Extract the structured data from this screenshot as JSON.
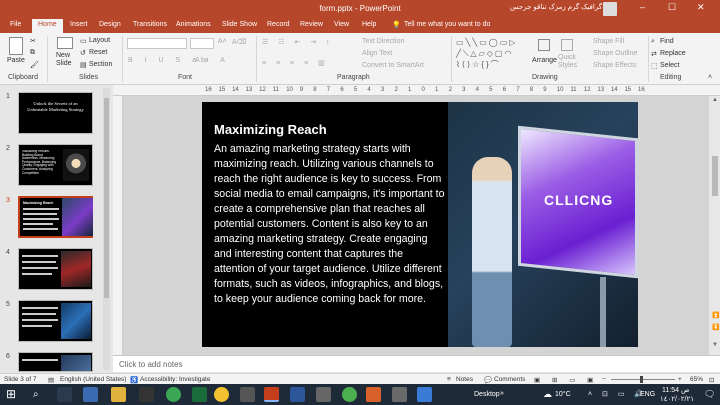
{
  "titlebar": {
    "autosave": "",
    "document": "form.pptx  -  PowerPoint",
    "user": "گرافیک گرم زمزک تناقو جرجس",
    "minimize": "–",
    "maximize": "☐",
    "close": "✕"
  },
  "ribbon_tabs": [
    "File",
    "Home",
    "Insert",
    "Design",
    "Transitions",
    "Animations",
    "Slide Show",
    "Record",
    "Review",
    "View",
    "Help"
  ],
  "tell_me": "Tell me what you want to do",
  "ribbon": {
    "clipboard": {
      "paste": "Paste",
      "label": "Clipboard"
    },
    "slides": {
      "new_slide": "New\nSlide",
      "layout": "Layout",
      "reset": "Reset",
      "section": "Section",
      "label": "Slides"
    },
    "font": {
      "label": "Font"
    },
    "paragraph": {
      "text_direction": "Text Direction",
      "align_text": "Align Text",
      "convert_smartart": "Convert to SmartArt",
      "label": "Paragraph"
    },
    "drawing": {
      "arrange": "Arrange",
      "quick_styles": "Quick\nStyles",
      "shape_fill": "Shape Fill",
      "shape_outline": "Shape Outline",
      "shape_effects": "Shape Effects",
      "label": "Drawing"
    },
    "editing": {
      "find": "Find",
      "replace": "Replace",
      "select": "Select",
      "label": "Editing"
    }
  },
  "thumbnails": [
    {
      "num": "1",
      "text": "Unlock the Secrets of an Unbeatable Marketing Strategy"
    },
    {
      "num": "2",
      "text": "Visualizing Results: Building Brand Awareness, Measuring Performance, Balancing Quality, Engaging with Customers, Analyzing Competition"
    },
    {
      "num": "3",
      "text": "Maximizing Reach"
    },
    {
      "num": "4",
      "text": ""
    },
    {
      "num": "5",
      "text": ""
    },
    {
      "num": "6",
      "text": ""
    }
  ],
  "ruler_ticks": [
    "16",
    "15",
    "14",
    "13",
    "12",
    "11",
    "10",
    "9",
    "8",
    "7",
    "6",
    "5",
    "4",
    "3",
    "2",
    "1",
    "0",
    "1",
    "2",
    "3",
    "4",
    "5",
    "6",
    "7",
    "8",
    "9",
    "10",
    "11",
    "12",
    "13",
    "14",
    "15",
    "16"
  ],
  "slide": {
    "heading": "Maximizing Reach",
    "body": "An amazing marketing strategy starts with maximizing reach. Utilizing various channels to reach the right audience is key to success. From social media to email campaigns, it's important to create a comprehensive plan that reaches all potential customers. Content is also key to an amazing marketing strategy. Create engaging and interesting content that captures the attention of your target audience. Utilize different formats, such as videos, infographics, and blogs, to keep your audience coming back for more.",
    "photo_screen_text": "CLLICNG"
  },
  "notes_placeholder": "Click to add notes",
  "status": {
    "slide_count": "Slide 3 of 7",
    "language": "English (United States)",
    "accessibility": "Accessibility: Investigate",
    "notes": "Notes",
    "comments": "Comments",
    "zoom": "65%"
  },
  "taskbar": {
    "desktop": "Desktop",
    "weather": "10°C",
    "time": "11:54 ص",
    "date": "١٤٠٢/٠٢/٢١",
    "lang": "ENG",
    "accent": "#1f2a38"
  }
}
